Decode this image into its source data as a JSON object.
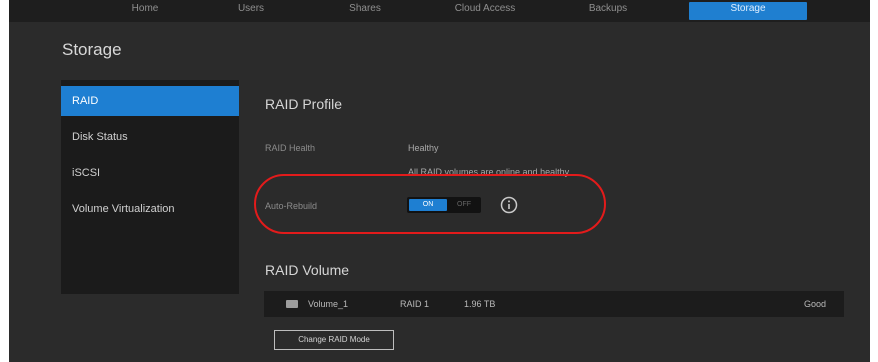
{
  "nav": {
    "items": [
      "Home",
      "Users",
      "Shares",
      "Cloud Access",
      "Backups",
      "Storage"
    ],
    "active_index": 5
  },
  "page": {
    "title": "Storage"
  },
  "sidebar": {
    "items": [
      {
        "label": "RAID",
        "active": true
      },
      {
        "label": "Disk Status",
        "active": false
      },
      {
        "label": "iSCSI",
        "active": false
      },
      {
        "label": "Volume Virtualization",
        "active": false
      }
    ]
  },
  "raid_profile": {
    "title": "RAID Profile",
    "status_label": "RAID Health",
    "status_value": "Healthy",
    "status_detail": "All RAID volumes are online and healthy.",
    "auto_rebuild_label": "Auto-Rebuild",
    "toggle_on_label": "ON",
    "toggle_off_label": "OFF",
    "toggle_state": "on"
  },
  "raid_volume": {
    "title": "RAID Volume",
    "row": {
      "name": "Volume_1",
      "raid": "RAID 1",
      "size": "1.96 TB",
      "status": "Good"
    },
    "change_button": "Change RAID Mode"
  },
  "colors": {
    "accent": "#1e7fd2",
    "highlight": "#e31b1b",
    "background": "#2b2b2b"
  },
  "icons": {
    "info": "info-circle-icon",
    "volume": "drive-icon"
  }
}
